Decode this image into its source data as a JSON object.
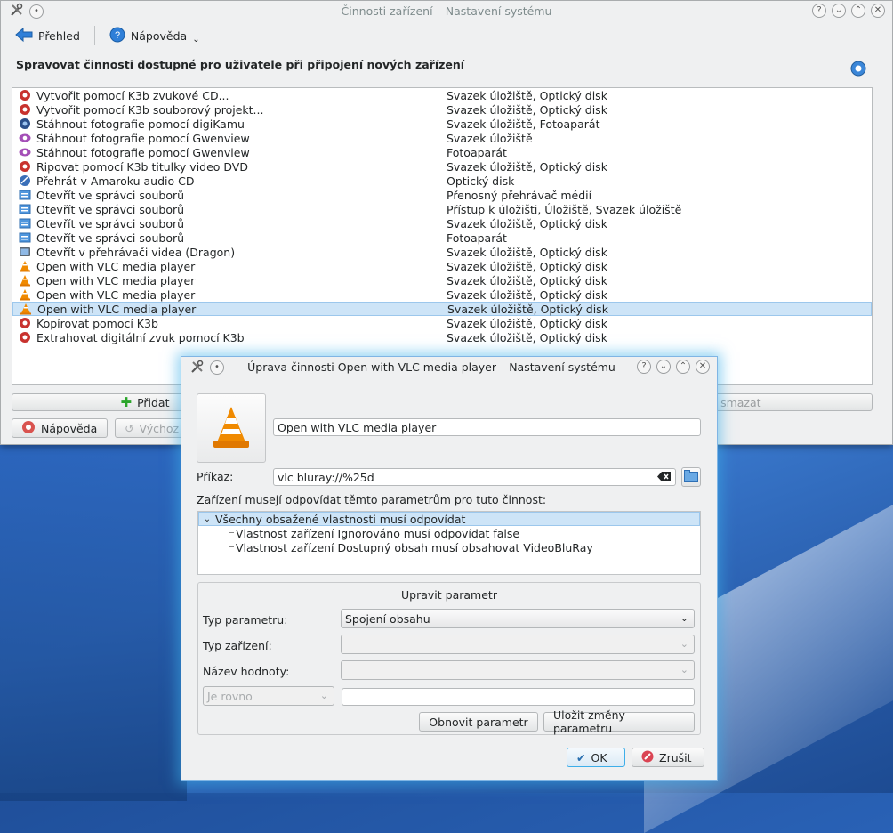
{
  "main_window": {
    "title": "Činnosti zařízení – Nastavení systému",
    "toolbar": {
      "overview": "Přehled",
      "help": "Nápověda"
    },
    "heading": "Spravovat činnosti dostupné pro uživatele při připojení nových zařízení",
    "actions": [
      {
        "name": "Vytvořit pomocí K3b zvukové CD...",
        "devices": "Svazek úložiště, Optický disk",
        "icon": "k3b-icon"
      },
      {
        "name": "Vytvořit pomocí K3b souborový projekt...",
        "devices": "Svazek úložiště, Optický disk",
        "icon": "k3b-icon"
      },
      {
        "name": "Stáhnout fotografie pomocí digiKamu",
        "devices": "Svazek úložiště, Fotoaparát",
        "icon": "digikam-icon"
      },
      {
        "name": "Stáhnout fotografie pomocí Gwenview",
        "devices": "Svazek úložiště",
        "icon": "gwenview-icon"
      },
      {
        "name": "Stáhnout fotografie pomocí Gwenview",
        "devices": "Fotoaparát",
        "icon": "gwenview-icon"
      },
      {
        "name": "Ripovat pomocí K3b titulky video DVD",
        "devices": "Svazek úložiště, Optický disk",
        "icon": "k3b-icon"
      },
      {
        "name": "Přehrát v Amaroku audio CD",
        "devices": "Optický disk",
        "icon": "amarok-icon"
      },
      {
        "name": "Otevřít ve správci souborů",
        "devices": "Přenosný přehrávač médií",
        "icon": "file-manager-icon"
      },
      {
        "name": "Otevřít ve správci souborů",
        "devices": "Přístup k úložišti, Úložiště, Svazek úložiště",
        "icon": "file-manager-icon"
      },
      {
        "name": "Otevřít ve správci souborů",
        "devices": "Svazek úložiště, Optický disk",
        "icon": "file-manager-icon"
      },
      {
        "name": "Otevřít ve správci souborů",
        "devices": "Fotoaparát",
        "icon": "file-manager-icon"
      },
      {
        "name": "Otevřít v přehrávači videa (Dragon)",
        "devices": "Svazek úložiště, Optický disk",
        "icon": "dragon-icon"
      },
      {
        "name": "Open with VLC media player",
        "devices": "Svazek úložiště, Optický disk",
        "icon": "vlc-icon"
      },
      {
        "name": "Open with VLC media player",
        "devices": "Svazek úložiště, Optický disk",
        "icon": "vlc-icon"
      },
      {
        "name": "Open with VLC media player",
        "devices": "Svazek úložiště, Optický disk",
        "icon": "vlc-icon"
      },
      {
        "name": "Open with VLC media player",
        "devices": "Svazek úložiště, Optický disk",
        "icon": "vlc-icon",
        "selected": true
      },
      {
        "name": "Kopírovat pomocí K3b",
        "devices": "Svazek úložiště, Optický disk",
        "icon": "k3b-icon"
      },
      {
        "name": "Extrahovat digitální zvuk pomocí K3b",
        "devices": "Svazek úložiště, Optický disk",
        "icon": "k3b-icon"
      }
    ],
    "buttons": {
      "add": "Přidat",
      "delete": "e smazat",
      "help": "Nápověda",
      "defaults": "Výchoz"
    }
  },
  "dialog": {
    "title": "Úprava činnosti Open with VLC media player – Nastavení systému",
    "action_name": "Open with VLC media player",
    "command_label": "Příkaz:",
    "command_value": "vlc bluray://%25d",
    "match_label": "Zařízení musejí odpovídat těmto parametrům pro tuto činnost:",
    "tree": [
      "Všechny obsažené vlastnosti musí odpovídat",
      "Vlastnost zařízení Ignorováno musí odpovídat false",
      "Vlastnost zařízení Dostupný obsah musí obsahovat VideoBluRay"
    ],
    "edit_group_title": "Upravit parametr",
    "param_type_label": "Typ parametru:",
    "param_type_value": "Spojení obsahu",
    "device_type_label": "Typ zařízení:",
    "value_name_label": "Název hodnoty:",
    "compare_value": "Je rovno",
    "reset_button": "Obnovit parametr",
    "save_button": "Uložit změny parametru",
    "ok_button": "OK",
    "cancel_button": "Zrušit"
  },
  "colors": {
    "accent": "#3daee9",
    "selection": "#cde4f7",
    "vlc_orange": "#f08a00"
  }
}
